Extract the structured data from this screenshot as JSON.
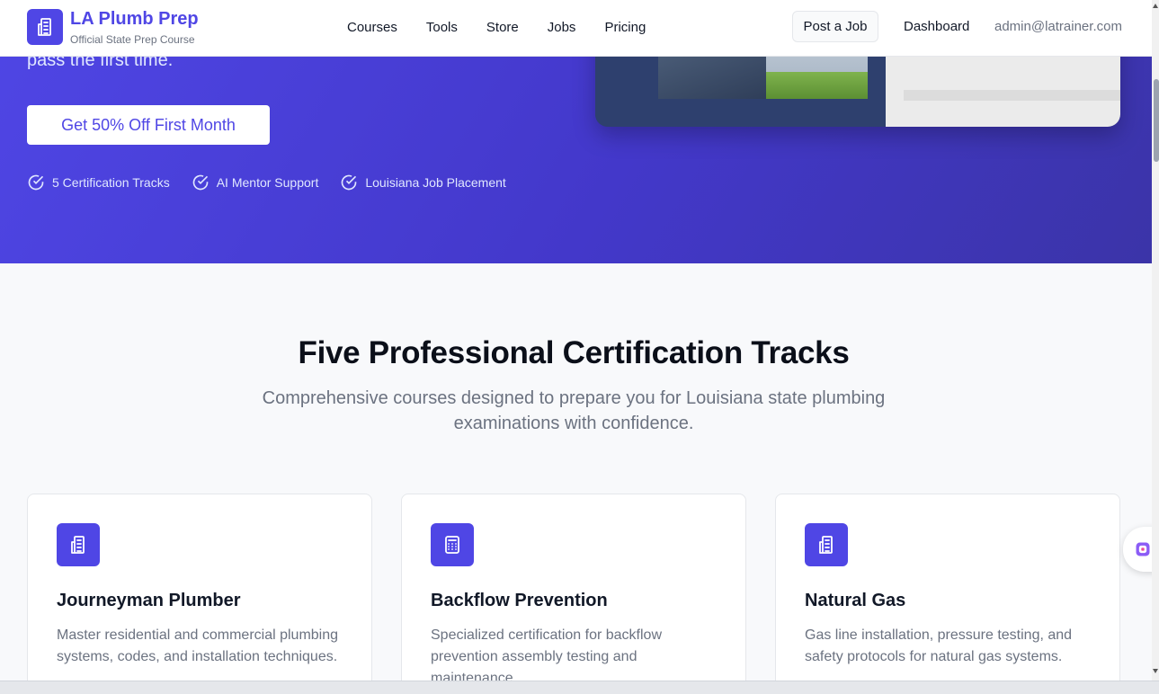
{
  "header": {
    "brand_title": "LA Plumb Prep",
    "brand_subtitle": "Official State Prep Course",
    "nav": [
      "Courses",
      "Tools",
      "Store",
      "Jobs",
      "Pricing"
    ],
    "post_job_label": "Post a Job",
    "dashboard_label": "Dashboard",
    "user_email": "admin@latrainer.com"
  },
  "hero": {
    "subtitle_tail": "pass the first time.",
    "cta_label": "Get 50% Off First Month",
    "features": [
      "5 Certification Tracks",
      "AI Mentor Support",
      "Louisiana Job Placement"
    ]
  },
  "tracks": {
    "title": "Five Professional Certification Tracks",
    "subtitle": "Comprehensive courses designed to prepare you for Louisiana state plumbing examinations with confidence.",
    "cards": [
      {
        "title": "Journeyman Plumber",
        "description": "Master residential and commercial plumbing systems, codes, and installation techniques.",
        "icon": "building-icon"
      },
      {
        "title": "Backflow Prevention",
        "description": "Specialized certification for backflow prevention assembly testing and maintenance.",
        "icon": "calculator-icon"
      },
      {
        "title": "Natural Gas",
        "description": "Gas line installation, pressure testing, and safety protocols for natural gas systems.",
        "icon": "building-icon"
      }
    ]
  },
  "colors": {
    "brand": "#4f46e5",
    "hero_gradient_end": "#3b34a8",
    "text_muted": "#6b7280"
  }
}
